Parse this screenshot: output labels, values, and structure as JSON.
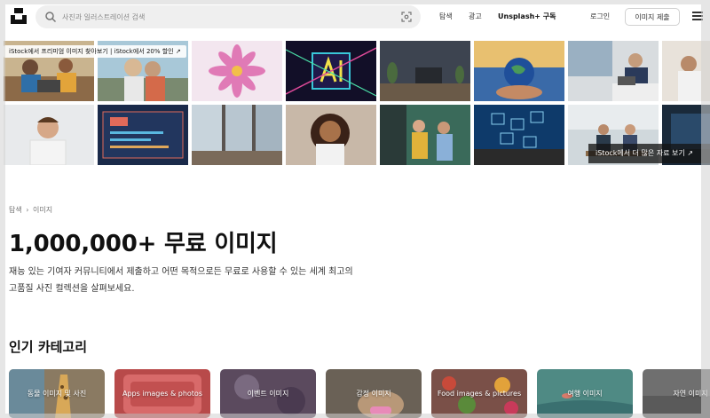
{
  "header": {
    "search_placeholder": "사진과 일러스트레이션 검색",
    "nav_explore": "탐색",
    "nav_ads": "광고",
    "nav_plus": "Unsplash+ 구독",
    "nav_login": "로그인",
    "submit_button": "이미지 제출"
  },
  "istock": {
    "promo_text": "iStock에서 프리미엄 이미지 찾아보기 | iStock에서 20% 할인 ↗",
    "more_text": "iStock에서 더 많은 자료 보기 ↗"
  },
  "breadcrumb": {
    "explore": "탐색",
    "separator": "›",
    "current": "이미지"
  },
  "hero": {
    "title": "1,000,000+ 무료 이미지",
    "description": "재능 있는 기여자 커뮤니티에서 제출하고 어떤 목적으로든 무료로 사용할 수 있는 세계 최고의 고품질 사진 컬렉션을 살펴보세요."
  },
  "categories": {
    "heading": "인기 카테고리",
    "items": [
      {
        "label": "동물 이미지 및 사진",
        "color": "#8a7a62"
      },
      {
        "label": "Apps images & photos",
        "color": "#b84a4a"
      },
      {
        "label": "이벤트 이미지",
        "color": "#5b4a5e"
      },
      {
        "label": "감정 이미지",
        "color": "#6a6156"
      },
      {
        "label": "Food images & pictures",
        "color": "#7a5048"
      },
      {
        "label": "여행 이미지",
        "color": "#4f8a84"
      },
      {
        "label": "자연 이미지",
        "color": "#6f6f6f"
      }
    ]
  },
  "colors": {
    "accent": "#111111",
    "search_bg": "#efefef"
  }
}
